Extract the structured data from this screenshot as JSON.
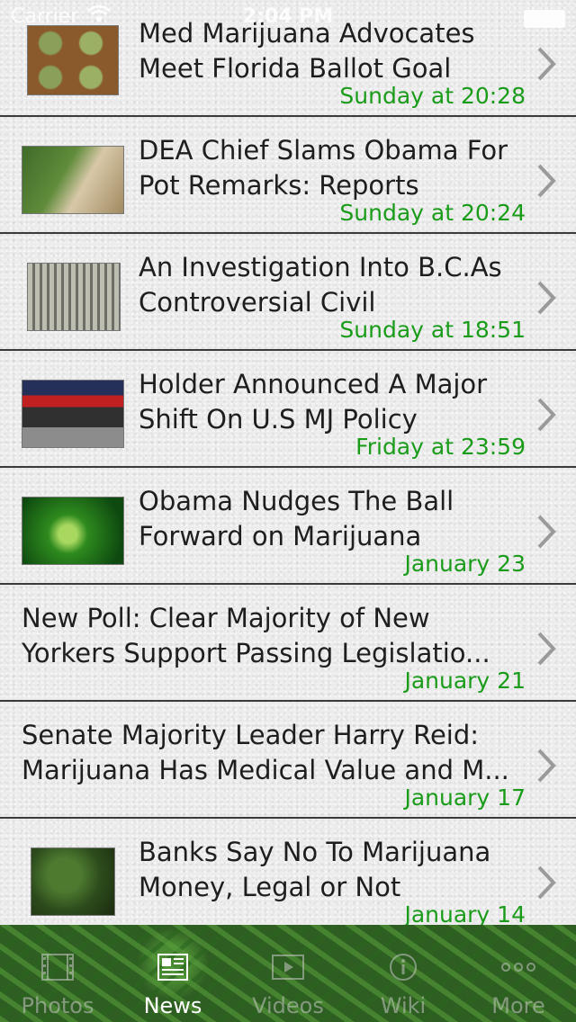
{
  "status_bar": {
    "carrier": "Carrier",
    "time": "2:04 PM"
  },
  "news": [
    {
      "title_line1": "Med Marijuana Advocates",
      "title_line2": "Meet Florida Ballot Goal",
      "date": "Sunday at 20:28",
      "has_thumb": true
    },
    {
      "title_line1": "DEA Chief Slams Obama For",
      "title_line2": "Pot Remarks: Reports",
      "date": "Sunday at 20:24",
      "has_thumb": true
    },
    {
      "title_line1": "An Investigation Into B.C.As",
      "title_line2": "Controversial Civil",
      "date": "Sunday at 18:51",
      "has_thumb": true
    },
    {
      "title_line1": "Holder Announced A Major",
      "title_line2": "Shift On U.S MJ Policy",
      "date": "Friday at 23:59",
      "has_thumb": true
    },
    {
      "title_line1": "Obama Nudges The Ball",
      "title_line2": "Forward on Marijuana",
      "date": "January 23",
      "has_thumb": true
    },
    {
      "title_line1": "New Poll: Clear Majority of New",
      "title_line2": "Yorkers Support Passing Legislatio...",
      "date": "January 21",
      "has_thumb": false
    },
    {
      "title_line1": "Senate Majority Leader Harry Reid:",
      "title_line2": "Marijuana Has Medical Value and M...",
      "date": "January 17",
      "has_thumb": false
    },
    {
      "title_line1": "Banks Say No To Marijuana",
      "title_line2": "Money, Legal or Not",
      "date": "January 14",
      "has_thumb": true
    }
  ],
  "tab_bar": {
    "active": "News",
    "tabs": [
      {
        "label": "Photos",
        "icon": "film-strip-icon"
      },
      {
        "label": "News",
        "icon": "newspaper-icon"
      },
      {
        "label": "Videos",
        "icon": "video-icon"
      },
      {
        "label": "Wiki",
        "icon": "info-icon"
      },
      {
        "label": "More",
        "icon": "more-dots-icon"
      }
    ]
  },
  "colors": {
    "date_green": "#1a9c1a",
    "title_text": "#1e1e1e",
    "separator": "#3a3a3a",
    "tab_active": "#ffffff"
  }
}
